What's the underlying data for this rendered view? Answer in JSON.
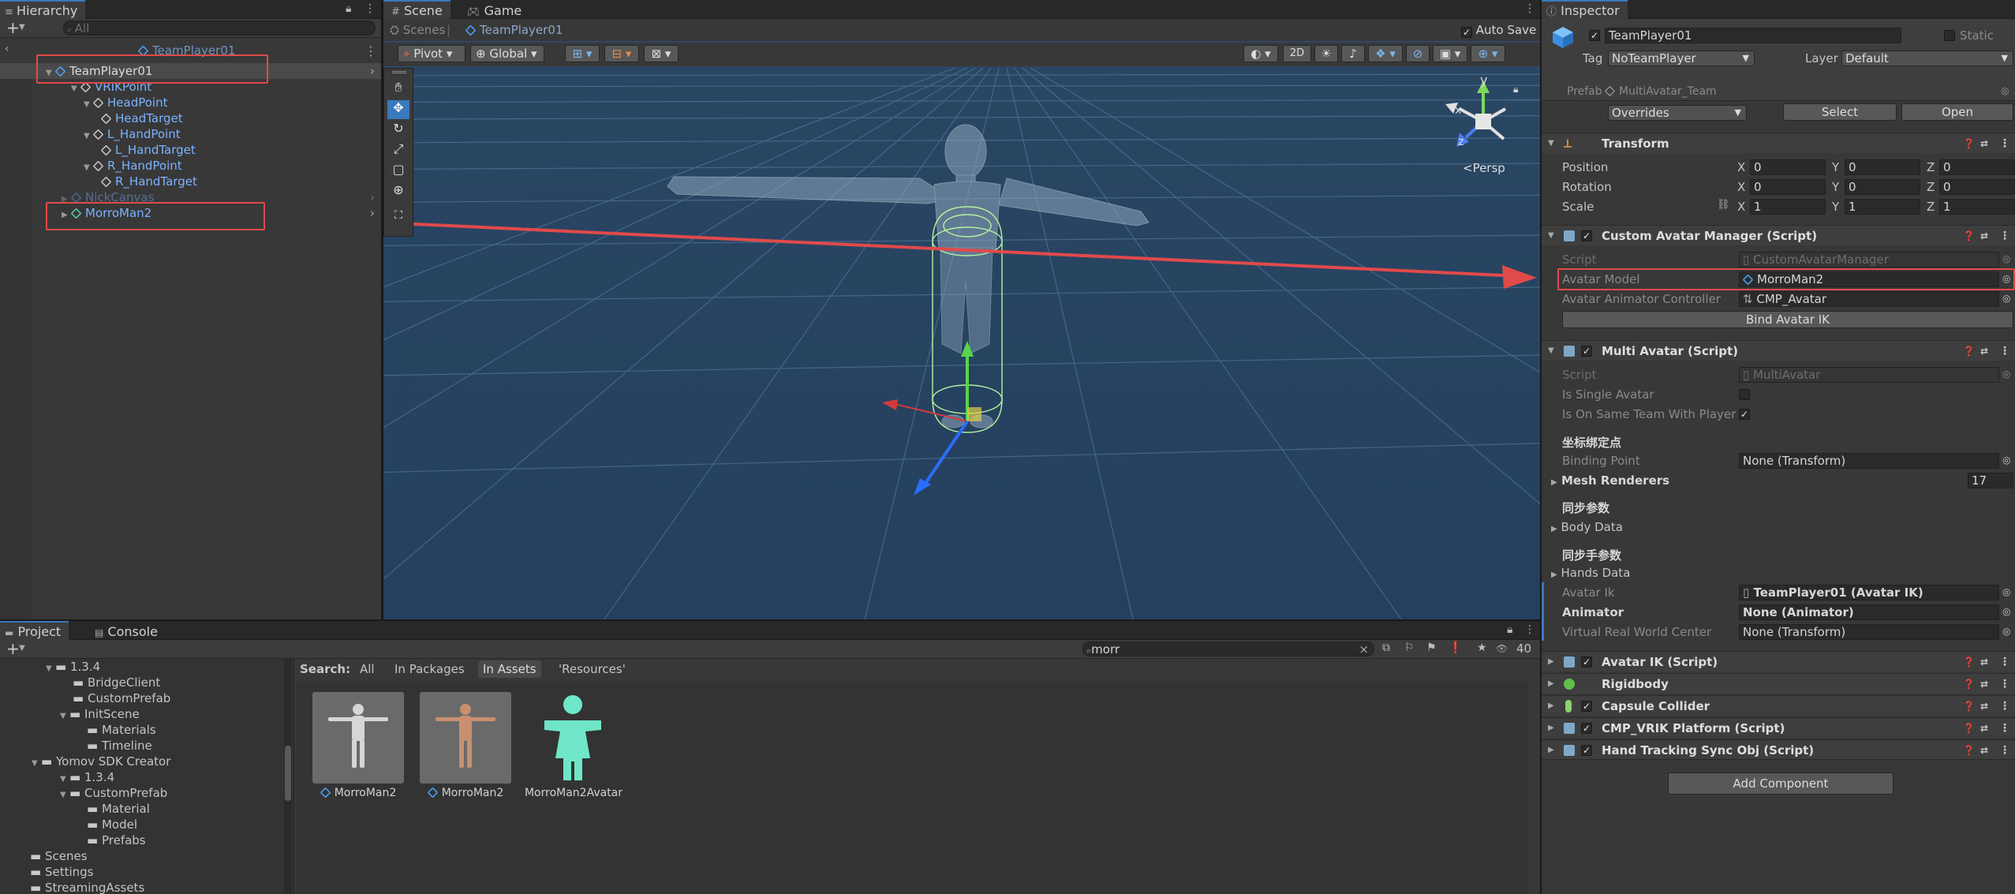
{
  "hierarchy": {
    "tab_label": "Hierarchy",
    "search_placeholder": "All",
    "scene_name": "TeamPlayer01",
    "items": [
      {
        "label": "TeamPlayer01"
      },
      {
        "label": "VRIKPoint"
      },
      {
        "label": "HeadPoint"
      },
      {
        "label": "HeadTarget"
      },
      {
        "label": "L_HandPoint"
      },
      {
        "label": "L_HandTarget"
      },
      {
        "label": "R_HandPoint"
      },
      {
        "label": "R_HandTarget"
      },
      {
        "label": "NickCanvas"
      },
      {
        "label": "MorroMan2"
      }
    ]
  },
  "scene": {
    "tab_scene": "Scene",
    "tab_game": "Game",
    "breadcrumb_root": "Scenes",
    "breadcrumb_current": "TeamPlayer01",
    "auto_save_label": "Auto Save",
    "pivot_label": "Pivot",
    "global_label": "Global",
    "mode_2d": "2D",
    "persp_label": "<Persp",
    "gizmo_y": "y",
    "gizmo_x": "x",
    "gizmo_z": "z"
  },
  "inspector": {
    "tab_label": "Inspector",
    "object_name": "TeamPlayer01",
    "static_label": "Static",
    "tag_label": "Tag",
    "tag_value": "NoTeamPlayer",
    "layer_label": "Layer",
    "layer_value": "Default",
    "prefab_label": "Prefab",
    "prefab_value": "MultiAvatar_Team",
    "overrides_label": "Overrides",
    "select_label": "Select",
    "open_label": "Open",
    "transform": {
      "title": "Transform",
      "position_label": "Position",
      "rotation_label": "Rotation",
      "scale_label": "Scale",
      "axis_x": "X",
      "axis_y": "Y",
      "axis_z": "Z",
      "position": [
        "0",
        "0",
        "0"
      ],
      "rotation": [
        "0",
        "0",
        "0"
      ],
      "scale": [
        "1",
        "1",
        "1"
      ]
    },
    "custom_avatar_manager": {
      "title": "Custom Avatar Manager (Script)",
      "script_label": "Script",
      "script_value": "CustomAvatarManager",
      "avatar_model_label": "Avatar Model",
      "avatar_model_value": "MorroMan2",
      "controller_label": "Avatar Animator Controller",
      "controller_value": "CMP_Avatar",
      "bind_button": "Bind Avatar IK"
    },
    "multi_avatar": {
      "title": "Multi Avatar (Script)",
      "script_label": "Script",
      "script_value": "MultiAvatar",
      "single_label": "Is Single Avatar",
      "same_team_label": "Is On Same Team With Player",
      "section_binding": "坐标绑定点",
      "binding_point_label": "Binding Point",
      "binding_point_value": "None (Transform)",
      "mesh_renderers_label": "Mesh Renderers",
      "mesh_renderers_count": "17",
      "section_sync": "同步参数",
      "body_data_label": "Body Data",
      "section_hand_sync": "同步手参数",
      "hands_data_label": "Hands Data",
      "avatar_ik_label": "Avatar Ik",
      "avatar_ik_value": "TeamPlayer01 (Avatar IK)",
      "animator_label": "Animator",
      "animator_value": "None (Animator)",
      "vr_center_label": "Virtual Real World Center",
      "vr_center_value": "None (Transform)"
    },
    "components": [
      {
        "title": "Avatar IK (Script)"
      },
      {
        "title": "Rigidbody"
      },
      {
        "title": "Capsule Collider"
      },
      {
        "title": "CMP_VRIK Platform (Script)"
      },
      {
        "title": "Hand Tracking Sync Obj (Script)"
      }
    ],
    "add_component": "Add Component"
  },
  "project": {
    "tab_project": "Project",
    "tab_console": "Console",
    "search_value": "morr",
    "result_count": "40",
    "search_label": "Search:",
    "filter_all": "All",
    "filter_packages": "In Packages",
    "filter_assets": "In Assets",
    "filter_resources": "'Resources'",
    "tree": [
      {
        "label": "1.3.4"
      },
      {
        "label": "BridgeClient"
      },
      {
        "label": "CustomPrefab"
      },
      {
        "label": "InitScene"
      },
      {
        "label": "Materials"
      },
      {
        "label": "Timeline"
      },
      {
        "label": "Yomov SDK Creator"
      },
      {
        "label": "1.3.4"
      },
      {
        "label": "CustomPrefab"
      },
      {
        "label": "Material"
      },
      {
        "label": "Model"
      },
      {
        "label": "Prefabs"
      },
      {
        "label": "Scenes"
      },
      {
        "label": "Settings"
      },
      {
        "label": "StreamingAssets"
      }
    ],
    "assets": [
      {
        "label": "MorroMan2"
      },
      {
        "label": "MorroMan2"
      },
      {
        "label": "MorroMan2Avatar"
      }
    ]
  },
  "colors": {
    "accent_blue": "#3a79bb",
    "annotation_red": "#e04a4a",
    "prefab_blue": "#7bb2ff",
    "scene_bg": "#2f4c6b"
  }
}
